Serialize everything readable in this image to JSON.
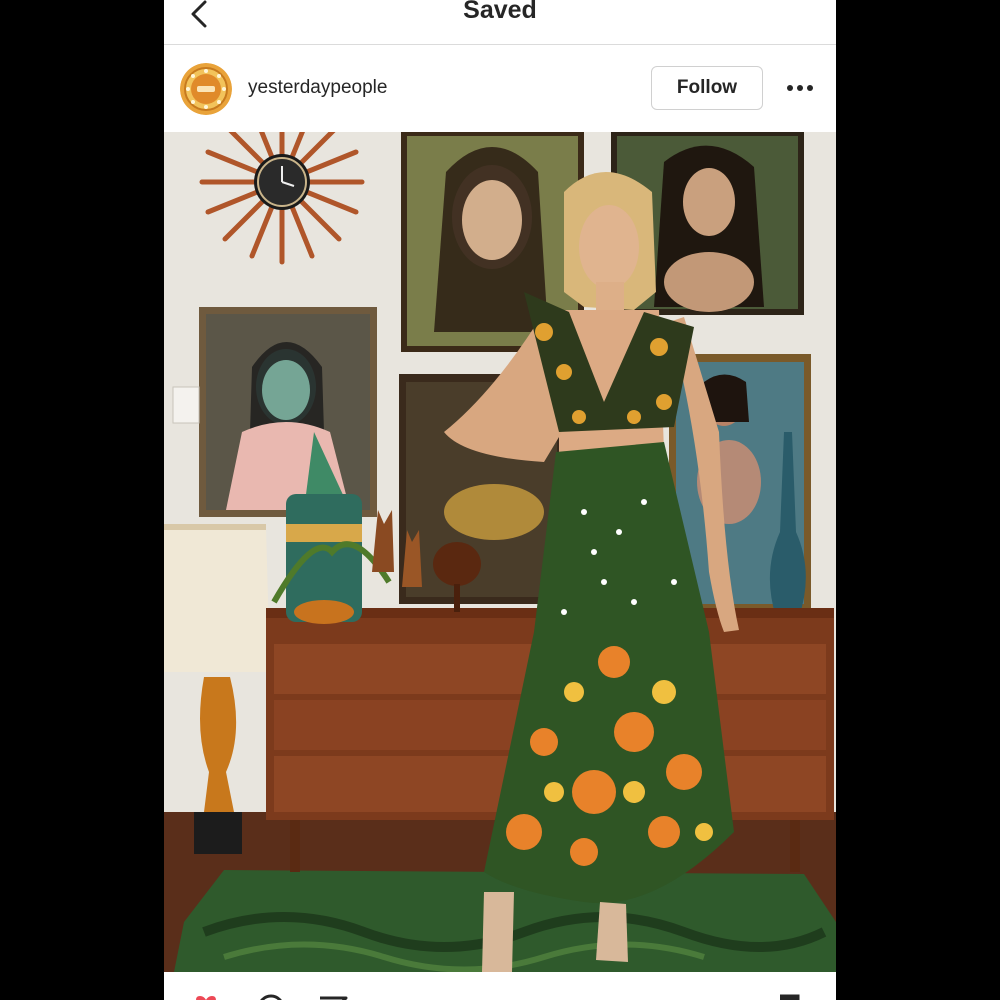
{
  "nav": {
    "title": "Saved",
    "back_icon": "chevron-left-icon"
  },
  "post": {
    "username": "yesterdaypeople",
    "follow_label": "Follow",
    "more_icon": "ellipsis-icon"
  },
  "actions": {
    "like_icon": "heart-icon",
    "comment_icon": "comment-icon",
    "share_icon": "share-icon",
    "save_icon": "bookmark-icon",
    "like_color": "#ed4956"
  }
}
